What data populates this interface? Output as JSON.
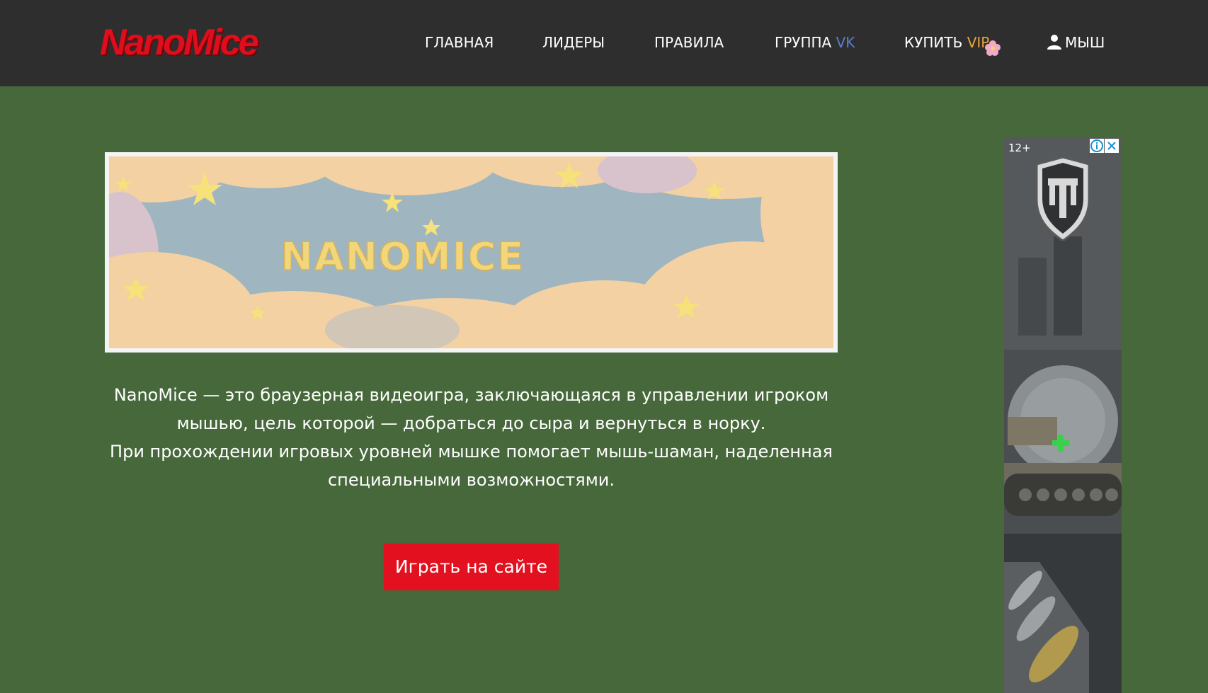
{
  "header": {
    "logo": "NanoMice",
    "nav": [
      {
        "label": "ГЛАВНАЯ"
      },
      {
        "label": "ЛИДЕРЫ"
      },
      {
        "label": "ПРАВИЛА"
      },
      {
        "label": "ГРУППА",
        "accent": "VK"
      },
      {
        "label": "КУПИТЬ",
        "accent": "VIP"
      },
      {
        "label": "МЫШ"
      }
    ],
    "icons": {
      "user": "user-icon",
      "vip": "flower-icon"
    }
  },
  "banner": {
    "text": "NANOMICE"
  },
  "main": {
    "description": [
      "NanoMice — это браузерная видеоигра, заключающаяся в управлении игроком мышью, цель которой — добраться до сыра и вернуться в норку.",
      "При прохождении игровых уровней мышке помогает мышь-шаман, наделенная специальными возможностями."
    ],
    "play_button": "Играть на сайте"
  },
  "ad": {
    "age": "12+",
    "icons": {
      "info": "info-icon",
      "close": "close-icon",
      "brand": "shield-logo-icon"
    }
  },
  "colors": {
    "header_bg": "#2e2e2e",
    "page_bg": "#46683a",
    "brand_red": "#e00d1c",
    "button_red": "#e3101f",
    "vk_accent": "#5b7bd6",
    "vip_accent": "#e8a33a"
  }
}
